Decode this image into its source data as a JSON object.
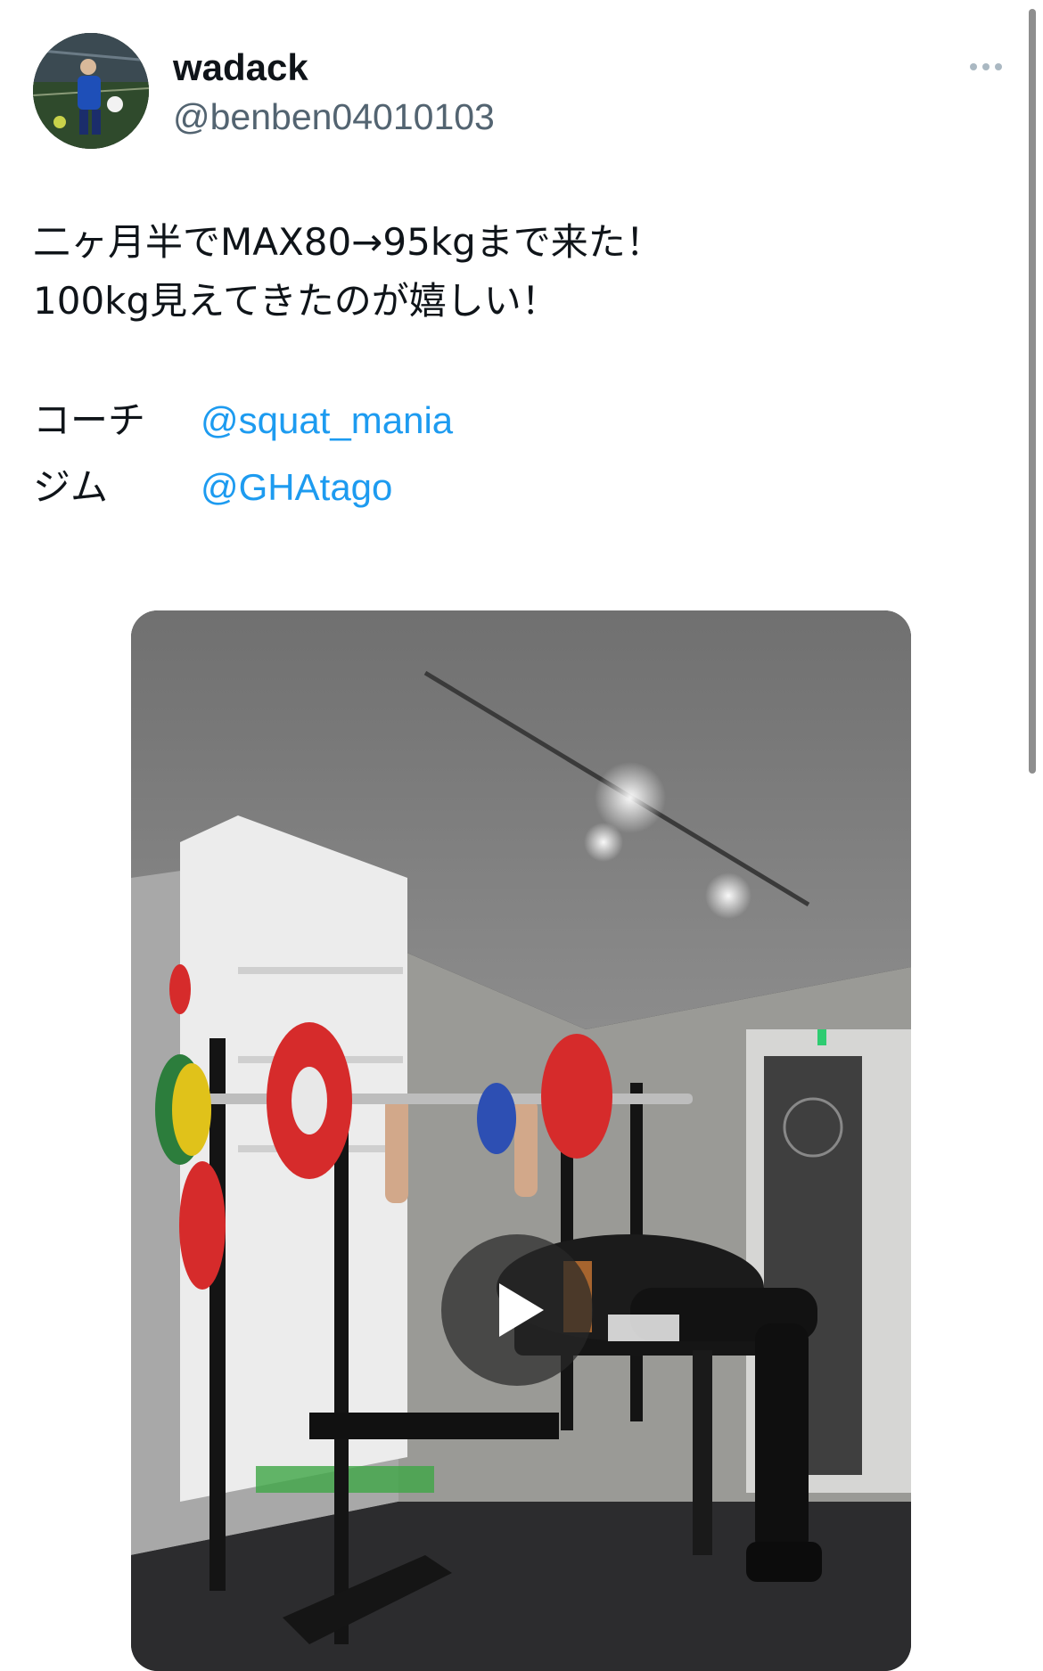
{
  "tweet": {
    "author": {
      "display_name": "wadack",
      "handle": "@benben04010103",
      "avatar_icon": "avatar-photo"
    },
    "more_icon": "more-horizontal-icon",
    "text_lines": [
      "二ヶ月半でMAX80→95kgまで来た！",
      "100kg見えてきたのが嬉しい！"
    ],
    "credits": [
      {
        "label": "コーチ",
        "mention": "@squat_mania"
      },
      {
        "label": "ジム",
        "mention": "@GHAtago"
      }
    ],
    "media": {
      "type": "video",
      "play_icon": "play-icon"
    }
  },
  "colors": {
    "text_primary": "#0f1419",
    "text_secondary": "#536471",
    "link": "#1d9bf0"
  }
}
